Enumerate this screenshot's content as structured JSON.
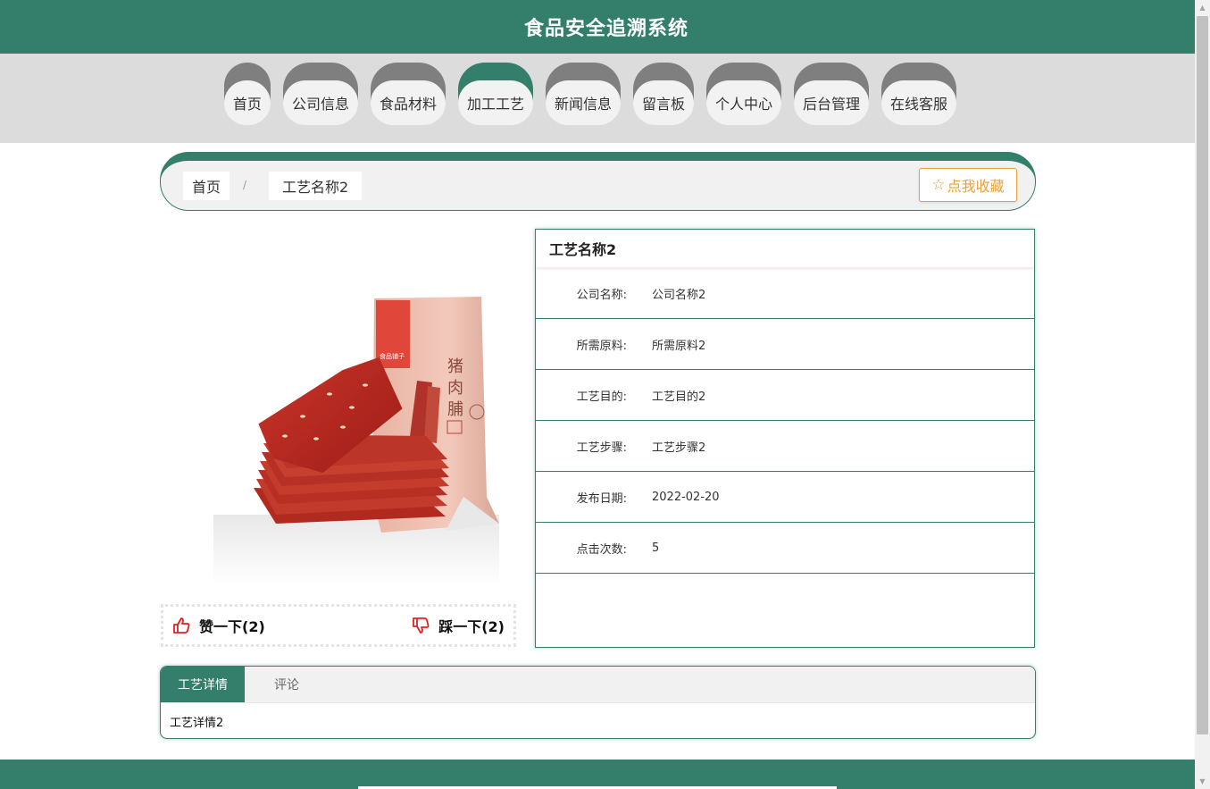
{
  "header": {
    "title": "食品安全追溯系统"
  },
  "nav": {
    "items": [
      {
        "label": "首页"
      },
      {
        "label": "公司信息"
      },
      {
        "label": "食品材料"
      },
      {
        "label": "加工工艺",
        "active": true
      },
      {
        "label": "新闻信息"
      },
      {
        "label": "留言板"
      },
      {
        "label": "个人中心"
      },
      {
        "label": "后台管理"
      },
      {
        "label": "在线客服"
      }
    ]
  },
  "breadcrumb": {
    "home": "首页",
    "separator": "/",
    "current": "工艺名称2"
  },
  "favorite": {
    "icon": "star-outline-icon",
    "label": "点我收藏"
  },
  "product": {
    "image_alt": "猪肉脯",
    "package_text": "猪肉脯"
  },
  "votes": {
    "like_label": "赞一下(2)",
    "dislike_label": "踩一下(2)"
  },
  "detail": {
    "title": "工艺名称2",
    "fields": [
      {
        "label": "公司名称:",
        "value": "公司名称2"
      },
      {
        "label": "所需原料:",
        "value": "所需原料2"
      },
      {
        "label": "工艺目的:",
        "value": "工艺目的2"
      },
      {
        "label": "工艺步骤:",
        "value": "工艺步骤2"
      },
      {
        "label": "发布日期:",
        "value": "2022-02-20"
      },
      {
        "label": "点击次数:",
        "value": "5"
      }
    ]
  },
  "tabs": {
    "items": [
      {
        "label": "工艺详情",
        "active": true
      },
      {
        "label": "评论"
      }
    ],
    "content": "工艺详情2"
  },
  "colors": {
    "primary": "#347f6b",
    "nav_cap": "#7f7f7f",
    "nav_bg": "#dcdcdc",
    "favorite": "#e6a23c",
    "vote_icon": "#e02020"
  }
}
